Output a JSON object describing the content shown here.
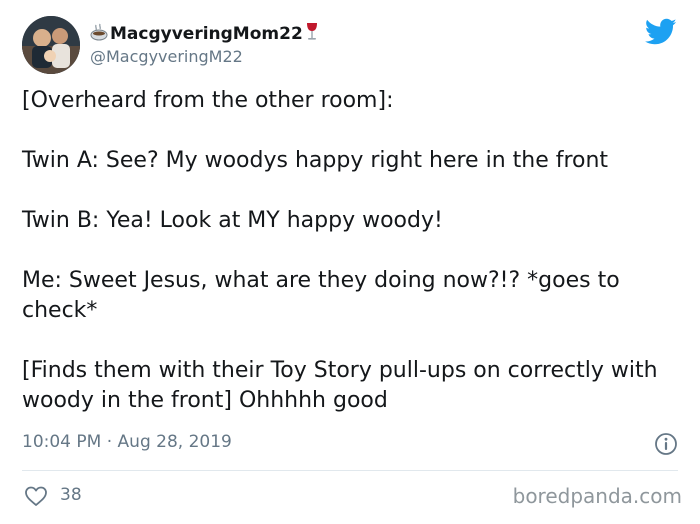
{
  "author": {
    "display_name": "MacgyveringMom22",
    "handle": "@MacgyveringM22",
    "name_prefix_icon": "hot-beverage-icon",
    "name_suffix_icon": "wine-glass-icon"
  },
  "tweet": {
    "paragraphs": [
      "[Overheard from the other room]:",
      "Twin A: See? My woodys happy right here in the front",
      "Twin B: Yea! Look at MY happy woody!",
      "Me: Sweet Jesus, what are they doing now?!? *goes to check*",
      "[Finds them with their Toy Story pull-ups on correctly with woody in the front] Ohhhhh good"
    ],
    "time": "10:04 PM",
    "separator": "·",
    "date": "Aug 28, 2019",
    "likes": "38"
  },
  "icons": {
    "brand": "twitter-bird-icon",
    "info": "info-icon",
    "like": "heart-icon"
  },
  "watermark": "boredpanda.com",
  "colors": {
    "twitter_blue": "#1da1f2",
    "secondary_text": "#657786",
    "primary_text": "#14171a",
    "divider": "#e1e8ed"
  }
}
